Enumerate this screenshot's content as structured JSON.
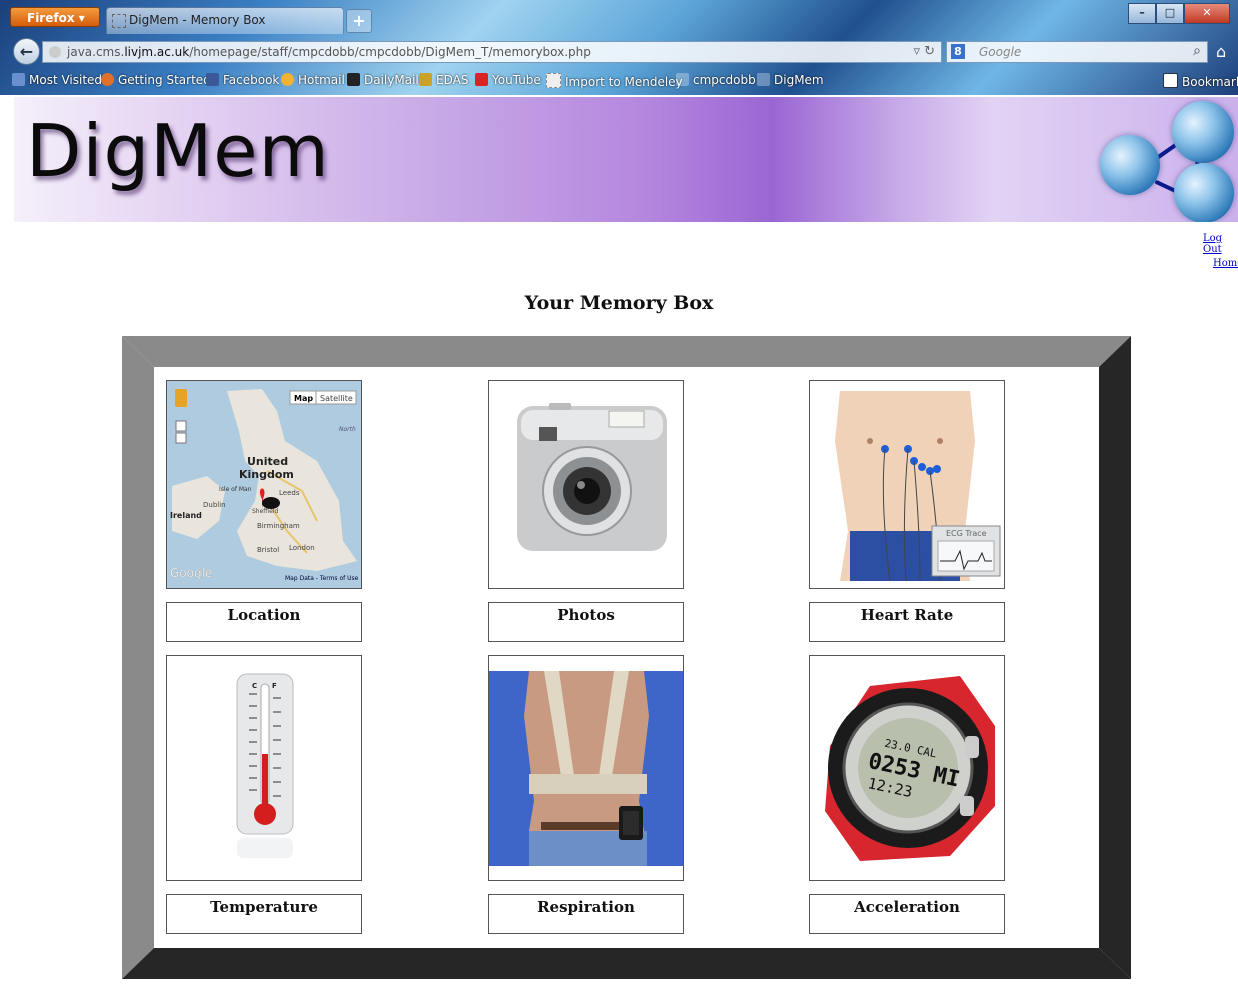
{
  "browser": {
    "app_button": "Firefox",
    "tab_title": "DigMem - Memory Box",
    "new_tab": "+",
    "url_prefix": "java.cms.",
    "url_domain": "livjm.ac.uk",
    "url_path": "/homepage/staff/cmpcdobb/cmpcdobb/DigMem_T/memorybox.php",
    "search_engine_letter": "8",
    "search_placeholder": "Google",
    "bookmarks": [
      "Most Visited",
      "Getting Started",
      "Facebook",
      "Hotmail",
      "DailyMail",
      "EDAS",
      "YouTube",
      "Import to Mendeley",
      "cmpcdobb",
      "DigMem"
    ],
    "bookmarks_menu": "Bookmarks"
  },
  "site": {
    "logo": "DigMem",
    "logout": "Log Out",
    "home": "Home",
    "heading": "Your Memory Box"
  },
  "map_thumb": {
    "map_button": "Map",
    "satellite_button": "Satellite",
    "labels": [
      "United",
      "Kingdom",
      "Isle of Man",
      "Leeds",
      "Dublin",
      "Ireland",
      "Sheffield",
      "Birmingham",
      "Bristol",
      "London",
      "North"
    ],
    "footer": "Map Data - Terms of Use",
    "google": "Google"
  },
  "ecg_thumb": {
    "caption": "ECG Trace"
  },
  "watch_thumb": {
    "line1": "23.0 CAL",
    "line2": "0253 MI",
    "line3": "12:23"
  },
  "cards": [
    {
      "label": "Location"
    },
    {
      "label": "Photos"
    },
    {
      "label": "Heart Rate"
    },
    {
      "label": "Temperature"
    },
    {
      "label": "Respiration"
    },
    {
      "label": "Acceleration"
    }
  ]
}
